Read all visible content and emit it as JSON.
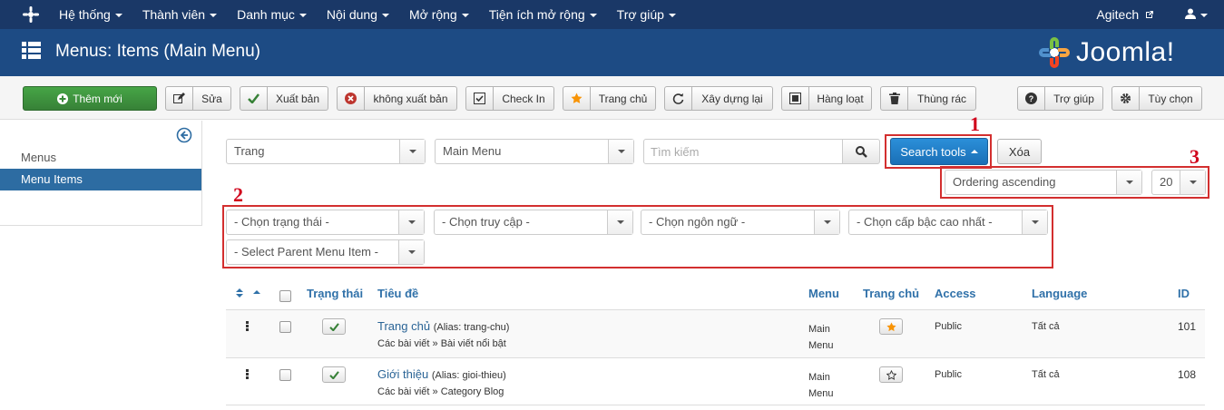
{
  "topnav": {
    "items": [
      "Hệ thống",
      "Thành viên",
      "Danh mục",
      "Nội dung",
      "Mở rộng",
      "Tiện ích mở rộng",
      "Trợ giúp"
    ],
    "site": "Agitech"
  },
  "header": {
    "title": "Menus: Items (Main Menu)",
    "brand": "Joomla!"
  },
  "toolbar": {
    "new": "Thêm mới",
    "edit": "Sửa",
    "publish": "Xuất bản",
    "unpublish": "không xuất bản",
    "checkin": "Check In",
    "home": "Trang chủ",
    "rebuild": "Xây dựng lại",
    "batch": "Hàng loạt",
    "trash": "Thùng rác",
    "help": "Trợ giúp",
    "options": "Tùy chọn"
  },
  "sidebar": {
    "items": [
      "Menus",
      "Menu Items"
    ],
    "active": "Menu Items"
  },
  "filters": {
    "client": "Trang",
    "menu": "Main Menu",
    "search_placeholder": "Tìm kiếm",
    "search_tools": "Search tools",
    "clear": "Xóa",
    "ordering": "Ordering ascending",
    "limit": "20",
    "state": "- Chọn trạng thái -",
    "access": "- Chọn truy cập -",
    "language": "- Chọn ngôn ngữ -",
    "level": "- Chọn cấp bậc cao nhất -",
    "parent": "- Select Parent Menu Item -"
  },
  "annotations": [
    "1",
    "2",
    "3"
  ],
  "annotation_color": "#d32f2f",
  "table": {
    "headers": {
      "status": "Trạng thái",
      "title": "Tiêu đề",
      "menu": "Menu",
      "home": "Trang chủ",
      "access": "Access",
      "language": "Language",
      "id": "ID"
    },
    "rows": [
      {
        "title": "Trang chủ",
        "alias": "(Alias: trang-chu)",
        "path": "Các bài viết » Bài viết nổi bật",
        "menu1": "Main",
        "menu2": "Menu",
        "home": true,
        "access": "Public",
        "language": "Tất cả",
        "id": "101"
      },
      {
        "title": "Giới thiệu",
        "alias": "(Alias: gioi-thieu)",
        "path": "Các bài viết » Category Blog",
        "menu1": "Main",
        "menu2": "Menu",
        "home": false,
        "access": "Public",
        "language": "Tất cả",
        "id": "108"
      }
    ]
  },
  "colors": {
    "topnav": "#1a3867",
    "header": "#1d4b84",
    "primary": "#2b8fd9",
    "success": "#46a546",
    "link": "#2a6496"
  }
}
